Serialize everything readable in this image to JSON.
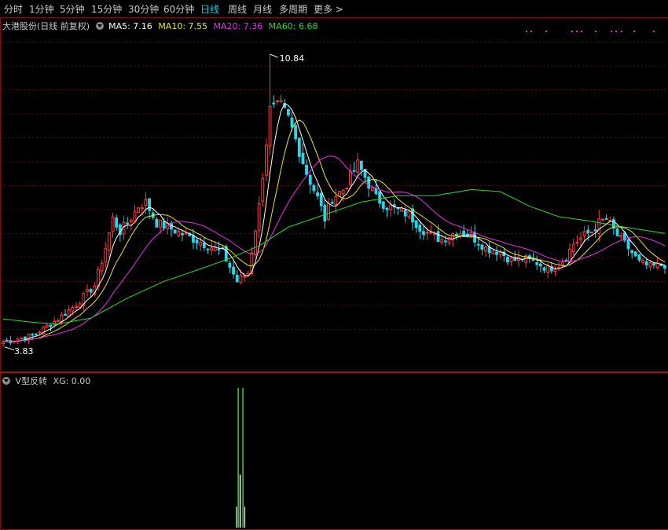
{
  "toolbar": {
    "tabs": [
      {
        "label": "分时",
        "active": false
      },
      {
        "label": "1分钟",
        "active": false
      },
      {
        "label": "5分钟",
        "active": false
      },
      {
        "label": "15分钟",
        "active": false
      },
      {
        "label": "30分钟",
        "active": false
      },
      {
        "label": "60分钟",
        "active": false
      },
      {
        "label": "日线",
        "active": true
      },
      {
        "label": "周线",
        "active": false
      },
      {
        "label": "月线",
        "active": false
      },
      {
        "label": "多周期",
        "active": false
      },
      {
        "label": "更多 >",
        "active": false
      }
    ]
  },
  "main_legend": {
    "title": "大港股份(日线 前复权)",
    "ma5": "MA5: 7.16",
    "ma10": "MA10: 7.55",
    "ma20": "MA20: 7.36",
    "ma60": "MA60: 6.68"
  },
  "colors": {
    "up": "#ff3d3d",
    "down": "#2fd3e8",
    "ma5": "#ffffff",
    "ma10": "#e6e632",
    "ma20": "#e632e6",
    "ma60": "#32d632",
    "grid": "#5a0e0e",
    "signal": "#32d632",
    "active_tab": "#1fc7e0"
  },
  "sub_legend": {
    "title": "V型反转",
    "value": "XG: 0.00"
  },
  "chart_data": {
    "type": "candlestick",
    "price_range": [
      3.3,
      11.5
    ],
    "annotations": {
      "high_label": "10.84",
      "low_label": "3.83"
    },
    "close_anchors": [
      [
        0,
        3.95
      ],
      [
        8,
        4.1
      ],
      [
        15,
        4.5
      ],
      [
        20,
        4.85
      ],
      [
        25,
        5.3
      ],
      [
        28,
        6.2
      ],
      [
        30,
        6.9
      ],
      [
        32,
        6.6
      ],
      [
        34,
        6.8
      ],
      [
        37,
        7.2
      ],
      [
        39,
        7.3
      ],
      [
        42,
        6.8
      ],
      [
        45,
        6.7
      ],
      [
        50,
        6.5
      ],
      [
        55,
        6.3
      ],
      [
        60,
        6.1
      ],
      [
        64,
        5.4
      ],
      [
        67,
        5.6
      ],
      [
        70,
        7.2
      ],
      [
        73,
        9.5
      ],
      [
        76,
        9.6
      ],
      [
        78,
        9.3
      ],
      [
        80,
        8.8
      ],
      [
        83,
        8.0
      ],
      [
        86,
        7.4
      ],
      [
        88,
        6.9
      ],
      [
        90,
        7.4
      ],
      [
        93,
        7.6
      ],
      [
        95,
        7.9
      ],
      [
        97,
        8.2
      ],
      [
        99,
        7.9
      ],
      [
        102,
        7.4
      ],
      [
        105,
        7.2
      ],
      [
        108,
        7.1
      ],
      [
        111,
        7.0
      ],
      [
        114,
        6.7
      ],
      [
        117,
        6.5
      ],
      [
        120,
        6.4
      ],
      [
        124,
        6.6
      ],
      [
        128,
        6.5
      ],
      [
        132,
        6.2
      ],
      [
        136,
        6.1
      ],
      [
        139,
        5.9
      ],
      [
        142,
        5.95
      ],
      [
        146,
        5.85
      ],
      [
        149,
        5.7
      ],
      [
        152,
        5.8
      ],
      [
        154,
        6.0
      ],
      [
        156,
        6.3
      ],
      [
        159,
        6.5
      ],
      [
        161,
        6.6
      ],
      [
        163,
        6.8
      ],
      [
        165,
        6.9
      ],
      [
        168,
        6.5
      ],
      [
        171,
        6.2
      ],
      [
        174,
        5.85
      ],
      [
        177,
        5.75
      ],
      [
        181,
        5.8
      ]
    ],
    "ma60_anchors": [
      [
        0,
        4.5
      ],
      [
        8,
        4.42
      ],
      [
        15,
        4.38
      ],
      [
        24,
        4.52
      ],
      [
        34,
        5.0
      ],
      [
        44,
        5.4
      ],
      [
        54,
        5.7
      ],
      [
        62,
        5.95
      ],
      [
        70,
        6.25
      ],
      [
        78,
        6.7
      ],
      [
        88,
        7.0
      ],
      [
        98,
        7.3
      ],
      [
        108,
        7.45
      ],
      [
        118,
        7.45
      ],
      [
        128,
        7.6
      ],
      [
        136,
        7.55
      ],
      [
        144,
        7.2
      ],
      [
        152,
        6.95
      ],
      [
        160,
        6.85
      ],
      [
        170,
        6.7
      ],
      [
        181,
        6.55
      ]
    ],
    "signal_bar": {
      "index": 65,
      "value": 1
    }
  }
}
